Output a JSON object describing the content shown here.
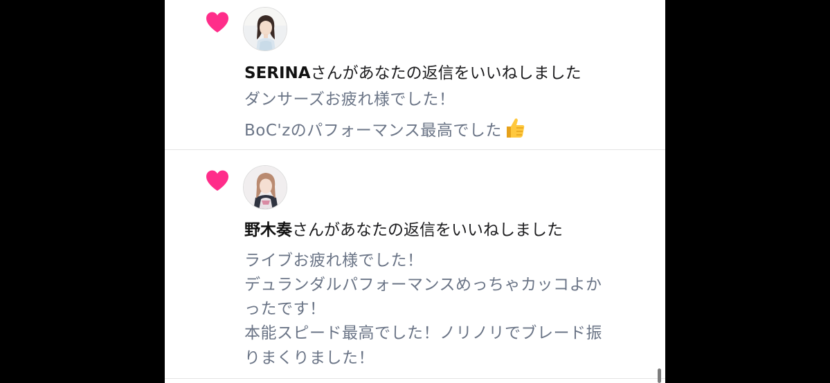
{
  "colors": {
    "heart": "#ff2d8a",
    "body_text": "#6a7486",
    "headline_text": "#1c1c1e",
    "panel_background": "#ffffff",
    "side_background": "#000000"
  },
  "notifications": [
    {
      "icon": "heart-icon",
      "avatar": "avatar-serina",
      "username": "SERINA",
      "action_text": "さんがあなたの返信をいいねしました",
      "body_lines": [
        "ダンサーズお疲れ様でした！",
        "BoC'zのパフォーマンス最高でした"
      ],
      "emoji": "thumbs-up-icon"
    },
    {
      "icon": "heart-icon",
      "avatar": "avatar-noki-kanade",
      "username": "野木奏",
      "action_text": "さんがあなたの返信をいいねしました",
      "body_lines": [
        "ライブお疲れ様でした！",
        "デュランダルパフォーマンスめっちゃカッコよか",
        "ったです！",
        "本能スピード最高でした！ノリノリでブレード振",
        "りまくりました！"
      ]
    }
  ]
}
